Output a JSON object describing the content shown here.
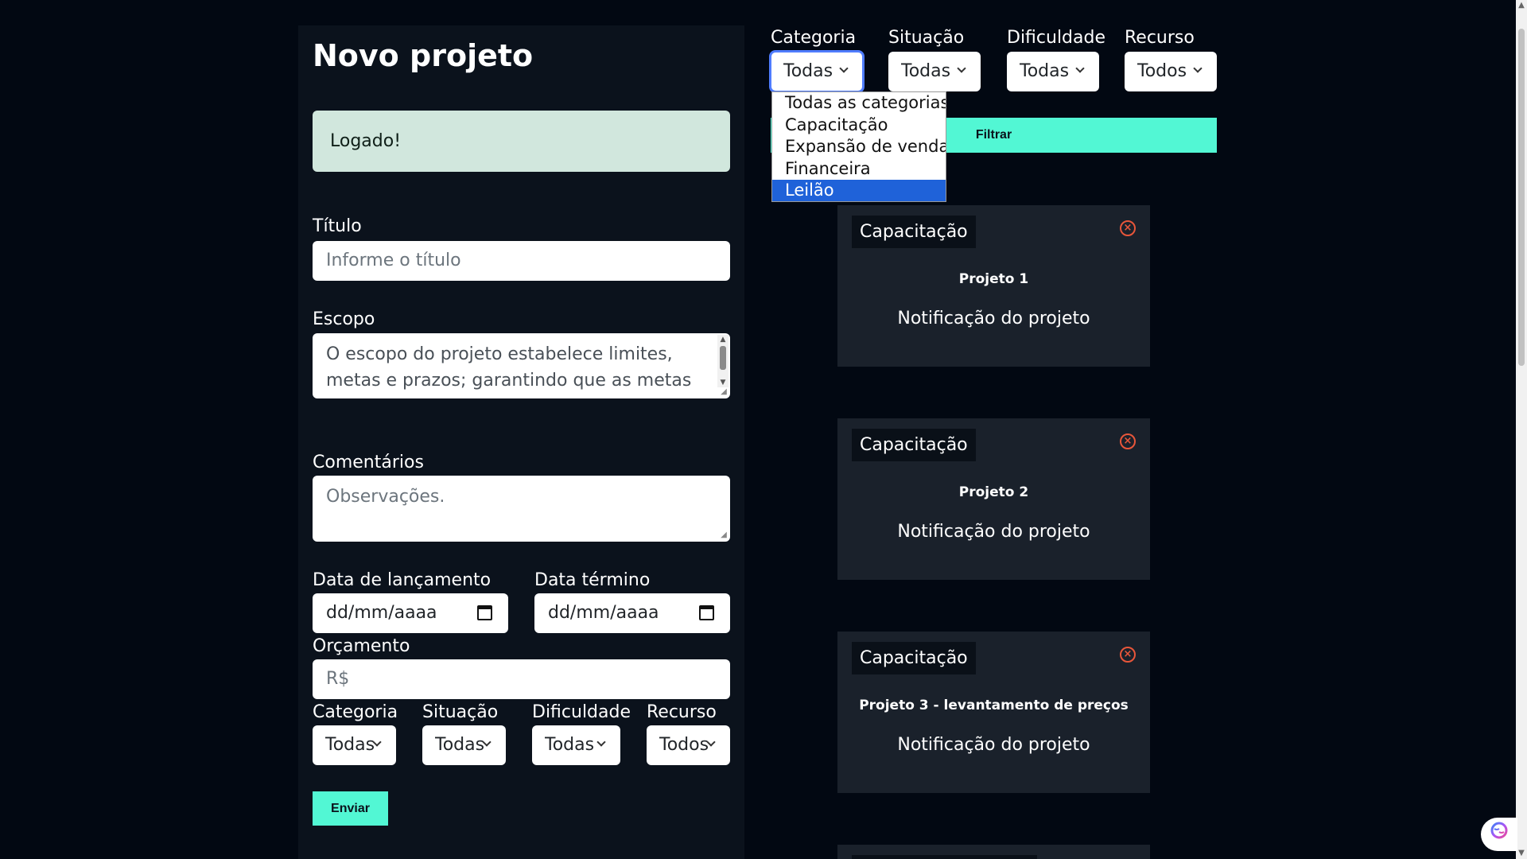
{
  "form": {
    "title": "Novo projeto",
    "alert": "Logado!",
    "titulo_label": "Título",
    "titulo_placeholder": "Informe o título",
    "escopo_label": "Escopo",
    "escopo_value": "O escopo do projeto estabelece limites, metas e prazos; garantindo que as metas e objetivos sejam atendidos de forma eficiente.",
    "comentarios_label": "Comentários",
    "comentarios_placeholder": "Observações.",
    "data_lancamento_label": "Data de lançamento",
    "data_lancamento_placeholder": "dd/mm/aaaa",
    "data_termino_label": "Data término",
    "data_termino_placeholder": "dd/mm/aaaa",
    "orcamento_label": "Orçamento",
    "orcamento_placeholder": "R$",
    "categoria_label": "Categoria",
    "categoria_value": "Todas",
    "situacao_label": "Situação",
    "situacao_value": "Todas",
    "dificuldade_label": "Dificuldade",
    "dificuldade_value": "Todas",
    "recurso_label": "Recurso",
    "recurso_value": "Todos",
    "submit_label": "Enviar"
  },
  "filters": {
    "categoria_label": "Categoria",
    "categoria_value": "Todas",
    "situacao_label": "Situação",
    "situacao_value": "Todas",
    "dificuldade_label": "Dificuldade",
    "dificuldade_value": "Todas",
    "recurso_label": "Recurso",
    "recurso_value": "Todos",
    "filter_label": "Filtrar"
  },
  "dropdown": {
    "options": [
      "Todas as categorias",
      "Capacitação",
      "Expansão de vendas",
      "Financeira",
      "Leilão"
    ],
    "selected_index": 4
  },
  "projects": [
    {
      "category": "Capacitação",
      "title": "Projeto 1",
      "description": "Notificação do projeto"
    },
    {
      "category": "Capacitação",
      "title": "Projeto 2",
      "description": "Notificação do projeto"
    },
    {
      "category": "Capacitação",
      "title": "Projeto 3 - levantamento de preços",
      "description": "Notificação do projeto"
    }
  ],
  "colors": {
    "accent": "#52f7d4",
    "alert_bg": "#d1e7dd",
    "close_icon": "#e8563a",
    "selected_option": "#1f62d9"
  },
  "icons": {
    "calendar": "calendar-icon",
    "close": "close-circle-icon",
    "chevron": "chevron-down-icon",
    "assistant": "brain-icon"
  }
}
